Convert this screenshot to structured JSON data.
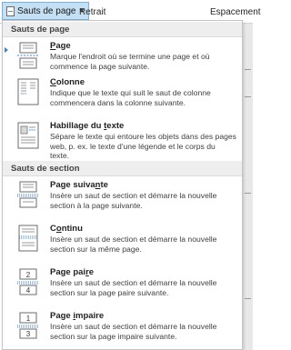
{
  "ribbon": {
    "dropdown_label": "Sauts de page",
    "retrait_label": "Retrait",
    "espacement_label": "Espacement"
  },
  "menu": {
    "section_page": "Sauts de page",
    "section_section": "Sauts de section",
    "items": [
      {
        "title_pre": "",
        "title_accel": "P",
        "title_post": "age",
        "desc": "Marque l'endroit où se termine une page et où commence la page suivante."
      },
      {
        "title_pre": "",
        "title_accel": "C",
        "title_post": "olonne",
        "desc": "Indique que le texte qui suit le saut de colonne commencera dans la colonne suivante."
      },
      {
        "title_pre": "Habillage du ",
        "title_accel": "t",
        "title_post": "exte",
        "desc": "Sépare le texte qui entoure les objets dans des pages web, p. ex. le texte d'une légende et le corps du texte."
      },
      {
        "title_pre": "Page suiva",
        "title_accel": "n",
        "title_post": "te",
        "desc": "Insère un saut de section et démarre la nouvelle section à la page suivante."
      },
      {
        "title_pre": "C",
        "title_accel": "o",
        "title_post": "ntinu",
        "desc": "Insère un saut de section et démarre la nouvelle section sur la même page."
      },
      {
        "title_pre": "Page pai",
        "title_accel": "r",
        "title_post": "e",
        "desc": "Insère un saut de section et démarre la nouvelle section sur la page paire suivante.",
        "icon_numbers": [
          "2",
          "4"
        ]
      },
      {
        "title_pre": "Page ",
        "title_accel": "i",
        "title_post": "mpaire",
        "desc": "Insère un saut de section et démarre la nouvelle section sur la page impaire suivante.",
        "icon_numbers": [
          "1",
          "3"
        ]
      }
    ]
  },
  "colors": {
    "accent": "#3c7fd6",
    "header_bg": "#eeeeee",
    "dropdown_active": "#c5dff3"
  },
  "icons": [
    "page-break-icon",
    "column-break-icon",
    "text-wrapping-break-icon",
    "next-page-section-icon",
    "continuous-section-icon",
    "even-page-section-icon",
    "odd-page-section-icon"
  ]
}
